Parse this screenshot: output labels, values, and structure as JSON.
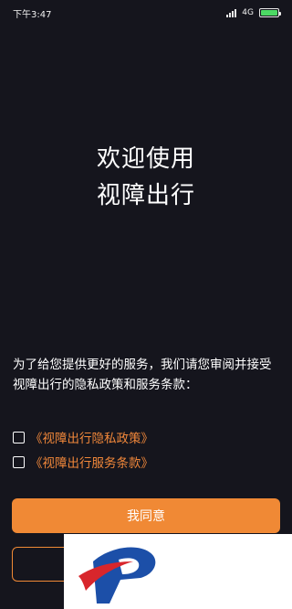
{
  "status_bar": {
    "time": "下午3:47",
    "network": "4G",
    "battery_level": 1.0,
    "battery_color": "#4cd964"
  },
  "welcome": {
    "line1": "欢迎使用",
    "line2": "视障出行"
  },
  "policy": {
    "text": "为了给您提供更好的服务，我们请您审阅并接受视障出行的隐私政策和服务条款：",
    "privacy_label": "《视障出行隐私政策》",
    "privacy_checked": false,
    "terms_label": "《视障出行服务条款》",
    "terms_checked": false
  },
  "buttons": {
    "agree_label": "我同意",
    "agree_color": "#f08935"
  },
  "watermark": {
    "logo": "stylized blue-and-red P logo"
  },
  "colors": {
    "background": "#15151d",
    "accent": "#f08935"
  }
}
